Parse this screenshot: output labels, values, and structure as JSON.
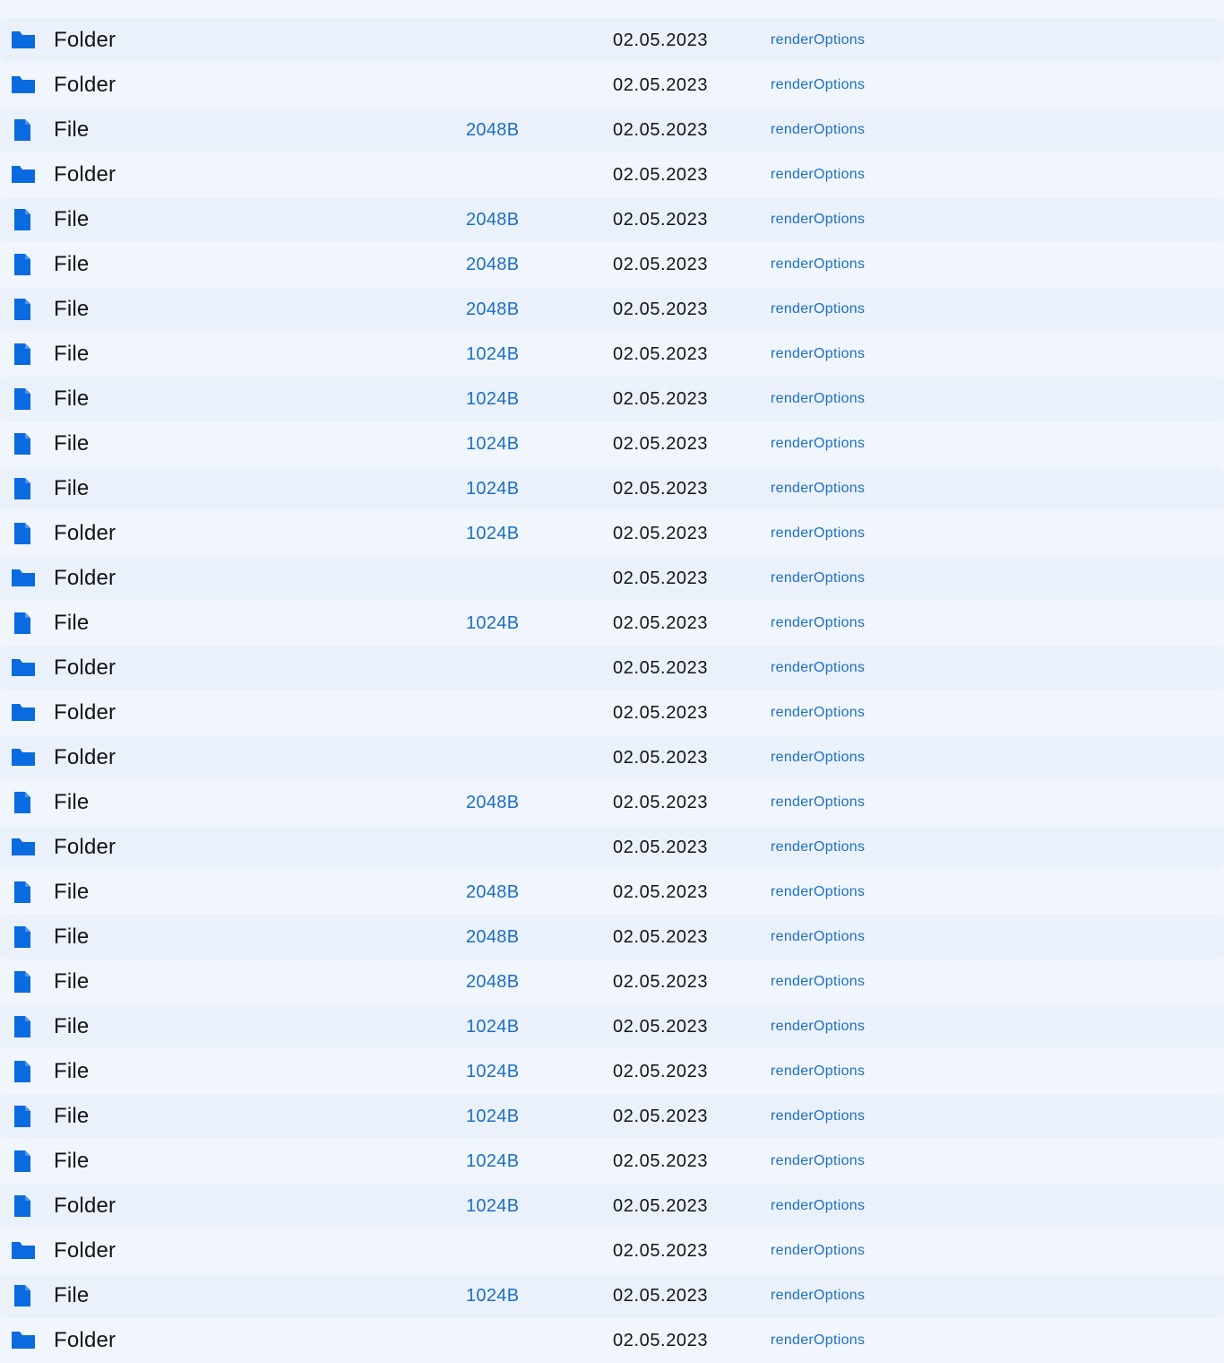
{
  "colors": {
    "background": "#f1f6fd",
    "row_alt": "#ebf1fa",
    "icon": "#0a6ae0",
    "link": "#1a6fc4",
    "text": "#111418"
  },
  "rows": [
    {
      "icon": "folder-icon",
      "name": "Folder",
      "size": "",
      "date": "02.05.2023",
      "options": "renderOptions"
    },
    {
      "icon": "folder-icon",
      "name": "Folder",
      "size": "",
      "date": "02.05.2023",
      "options": "renderOptions"
    },
    {
      "icon": "file-icon",
      "name": "File",
      "size": "2048B",
      "date": "02.05.2023",
      "options": "renderOptions"
    },
    {
      "icon": "folder-icon",
      "name": "Folder",
      "size": "",
      "date": "02.05.2023",
      "options": "renderOptions"
    },
    {
      "icon": "file-icon",
      "name": "File",
      "size": "2048B",
      "date": "02.05.2023",
      "options": "renderOptions"
    },
    {
      "icon": "file-icon",
      "name": "File",
      "size": "2048B",
      "date": "02.05.2023",
      "options": "renderOptions"
    },
    {
      "icon": "file-icon",
      "name": "File",
      "size": "2048B",
      "date": "02.05.2023",
      "options": "renderOptions"
    },
    {
      "icon": "file-icon",
      "name": "File",
      "size": "1024B",
      "date": "02.05.2023",
      "options": "renderOptions"
    },
    {
      "icon": "file-icon",
      "name": "File",
      "size": "1024B",
      "date": "02.05.2023",
      "options": "renderOptions"
    },
    {
      "icon": "file-icon",
      "name": "File",
      "size": "1024B",
      "date": "02.05.2023",
      "options": "renderOptions"
    },
    {
      "icon": "file-icon",
      "name": "File",
      "size": "1024B",
      "date": "02.05.2023",
      "options": "renderOptions"
    },
    {
      "icon": "file-icon",
      "name": "Folder",
      "size": "1024B",
      "date": "02.05.2023",
      "options": "renderOptions"
    },
    {
      "icon": "folder-icon",
      "name": "Folder",
      "size": "",
      "date": "02.05.2023",
      "options": "renderOptions"
    },
    {
      "icon": "file-icon",
      "name": "File",
      "size": "1024B",
      "date": "02.05.2023",
      "options": "renderOptions"
    },
    {
      "icon": "folder-icon",
      "name": "Folder",
      "size": "",
      "date": "02.05.2023",
      "options": "renderOptions"
    },
    {
      "icon": "folder-icon",
      "name": "Folder",
      "size": "",
      "date": "02.05.2023",
      "options": "renderOptions"
    },
    {
      "icon": "folder-icon",
      "name": "Folder",
      "size": "",
      "date": "02.05.2023",
      "options": "renderOptions"
    },
    {
      "icon": "file-icon",
      "name": "File",
      "size": "2048B",
      "date": "02.05.2023",
      "options": "renderOptions"
    },
    {
      "icon": "folder-icon",
      "name": "Folder",
      "size": "",
      "date": "02.05.2023",
      "options": "renderOptions"
    },
    {
      "icon": "file-icon",
      "name": "File",
      "size": "2048B",
      "date": "02.05.2023",
      "options": "renderOptions"
    },
    {
      "icon": "file-icon",
      "name": "File",
      "size": "2048B",
      "date": "02.05.2023",
      "options": "renderOptions"
    },
    {
      "icon": "file-icon",
      "name": "File",
      "size": "2048B",
      "date": "02.05.2023",
      "options": "renderOptions"
    },
    {
      "icon": "file-icon",
      "name": "File",
      "size": "1024B",
      "date": "02.05.2023",
      "options": "renderOptions"
    },
    {
      "icon": "file-icon",
      "name": "File",
      "size": "1024B",
      "date": "02.05.2023",
      "options": "renderOptions"
    },
    {
      "icon": "file-icon",
      "name": "File",
      "size": "1024B",
      "date": "02.05.2023",
      "options": "renderOptions"
    },
    {
      "icon": "file-icon",
      "name": "File",
      "size": "1024B",
      "date": "02.05.2023",
      "options": "renderOptions"
    },
    {
      "icon": "file-icon",
      "name": "Folder",
      "size": "1024B",
      "date": "02.05.2023",
      "options": "renderOptions"
    },
    {
      "icon": "folder-icon",
      "name": "Folder",
      "size": "",
      "date": "02.05.2023",
      "options": "renderOptions"
    },
    {
      "icon": "file-icon",
      "name": "File",
      "size": "1024B",
      "date": "02.05.2023",
      "options": "renderOptions"
    },
    {
      "icon": "folder-icon",
      "name": "Folder",
      "size": "",
      "date": "02.05.2023",
      "options": "renderOptions"
    }
  ]
}
